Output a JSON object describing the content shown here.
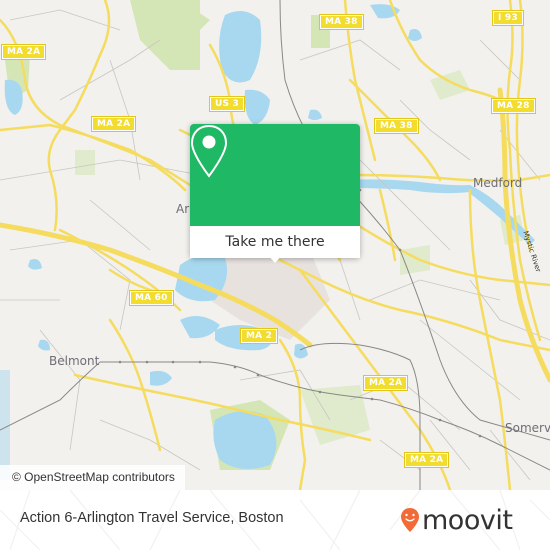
{
  "map": {
    "place_labels": {
      "medford": "Medford",
      "belmont": "Belmont",
      "somerville": "Somerv",
      "arlington": "Ar",
      "mystic_river": "Mystic River"
    },
    "route_shields": {
      "ma2a_nw": "MA 2A",
      "ma2a_w": "MA 2A",
      "us3": "US 3",
      "ma38_n": "MA 38",
      "ma38_c": "MA 38",
      "i93": "I 93",
      "ma28": "MA 28",
      "ma60": "MA 60",
      "ma2": "MA 2",
      "ma2a_c": "MA 2A",
      "ma2a_s": "MA 2A"
    },
    "attribution": "© OpenStreetMap contributors",
    "colors": {
      "land": "#f2f1ed",
      "water": "#a8d8f0",
      "park": "#d4e6b5",
      "road": "#f5dc5e",
      "minor_road": "#c8c6c0",
      "rail": "#888888"
    }
  },
  "popup": {
    "icon": "map-pin-icon",
    "button_label": "Take me there",
    "color": "#1fb865"
  },
  "footer": {
    "title": "Action 6-Arlington Travel Service, Boston",
    "logo_text": "moovit",
    "logo_icon": "moovit-smile-pin-icon",
    "logo_color": "#f26b36"
  }
}
